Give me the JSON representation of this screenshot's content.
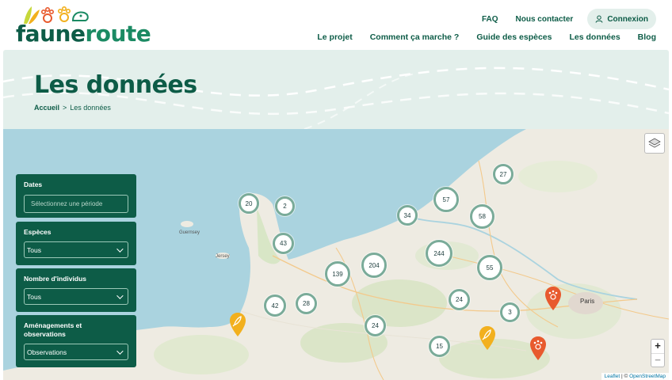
{
  "brand": {
    "name_part1": "faune",
    "name_part2": "route"
  },
  "top_nav": {
    "faq": "FAQ",
    "contact": "Nous contacter",
    "login": "Connexion"
  },
  "main_nav": [
    "Le projet",
    "Comment ça marche ?",
    "Guide des espèces",
    "Les données",
    "Blog"
  ],
  "hero": {
    "title": "Les données",
    "breadcrumb_home": "Accueil",
    "breadcrumb_sep": ">",
    "breadcrumb_current": "Les données"
  },
  "filters": {
    "dates": {
      "label": "Dates",
      "placeholder": "Sélectionnez une période"
    },
    "species": {
      "label": "Espèces",
      "value": "Tous"
    },
    "count": {
      "label": "Nombre d'individus",
      "value": "Tous"
    },
    "amenagements": {
      "label": "Aménagements et observations",
      "value": "Observations"
    }
  },
  "clusters": [
    "20",
    "2",
    "27",
    "57",
    "34",
    "58",
    "43",
    "204",
    "244",
    "139",
    "55",
    "24",
    "28",
    "42",
    "3",
    "24",
    "15"
  ],
  "map_places": [
    "Guernsey",
    "Jersey",
    "Paris"
  ],
  "attribution": {
    "leaflet": "Leaflet",
    "sep": "| ©",
    "osm": "OpenStreetMap"
  },
  "zoom": {
    "in": "+",
    "out": "−"
  },
  "colors": {
    "primary": "#0d5c47",
    "hero_bg": "#e3efeb",
    "sea": "#aad3df",
    "cluster_ring": "#7aab99",
    "pin_orange": "#e85a2e",
    "pin_yellow": "#f2b01e"
  },
  "icons": [
    "paw-logo-icon",
    "user-icon",
    "chevron-down-icon",
    "layers-icon",
    "feather-pin-icon",
    "paw-pin-icon"
  ]
}
